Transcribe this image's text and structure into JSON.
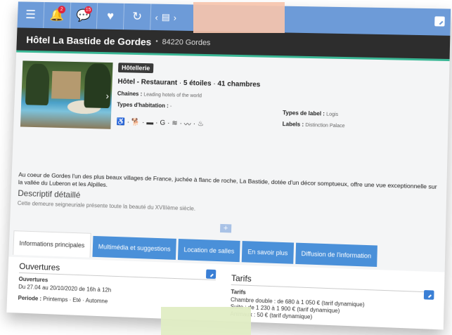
{
  "topbar": {
    "menu_icon": "menu-icon",
    "notifications": {
      "icon": "bell-icon",
      "count": "2"
    },
    "messages": {
      "icon": "chat-icon",
      "count": "15"
    },
    "favorites_icon": "heart-icon",
    "share_icon": "share-icon",
    "nav_prev": "‹",
    "nav_list_icon": "list-icon",
    "nav_next": "›",
    "edit_icon": "edit-icon",
    "accent_color": "#6d9bd8"
  },
  "header": {
    "hotel_name": "Hôtel La Bastide de Gordes",
    "separator": "•",
    "location": "84220 Gordes"
  },
  "info": {
    "category_badge": "Hôtellerie",
    "type": "Hôtel - Restaurant",
    "stars": "5 étoiles",
    "rooms": "41 chambres",
    "chains_label": "Chaines :",
    "chains_value": "Leading hotels of the world",
    "habitation_label": "Types d'habitation :",
    "habitation_value": "-",
    "label_types_label": "Types de label :",
    "label_types_value": "Logis",
    "labels_label": "Labels :",
    "labels_value": "Distinction Palace",
    "amenities": [
      "wheelchair-icon",
      "pet-icon",
      "parking-icon",
      "golf-icon",
      "wifi-icon",
      "pool-icon",
      "restaurant-icon"
    ]
  },
  "description": {
    "text": "Au coeur de Gordes l'un des plus beaux villages de France, juchée à flanc de roche, La Bastide, dotée d'un décor somptueux, offre une vue exceptionnelle sur la vallée du Luberon et les Alpilles.",
    "detail_heading": "Descriptif détaillé",
    "detail_text": "Cette demeure seigneuriale présente toute la beauté du XVIIIème siècle."
  },
  "expand_label": "+",
  "tabs": [
    {
      "label": "Informations principales",
      "active": true
    },
    {
      "label": "Multimédia et suggestions",
      "active": false
    },
    {
      "label": "Location de salles",
      "active": false
    },
    {
      "label": "En savoir plus",
      "active": false
    },
    {
      "label": "Diffusion de l'information",
      "active": false
    }
  ],
  "openings": {
    "title": "Ouvertures",
    "sub": "Ouvertures",
    "dates": "Du 27.04 au 20/10/2020 de 16h à 12h",
    "period_label": "Periode :",
    "period_values": "Printemps · Eté · Automne"
  },
  "rates": {
    "title": "Tarifs",
    "sub": "Tarifs",
    "line1": "Chambre double : de 680 à 1 050 € (tarif dynamique)",
    "line2": "Suite : de 1 230 à 1 900 € (tarif dynamique)",
    "line3": "Animaux : 50 € (tarif dynamique)"
  }
}
